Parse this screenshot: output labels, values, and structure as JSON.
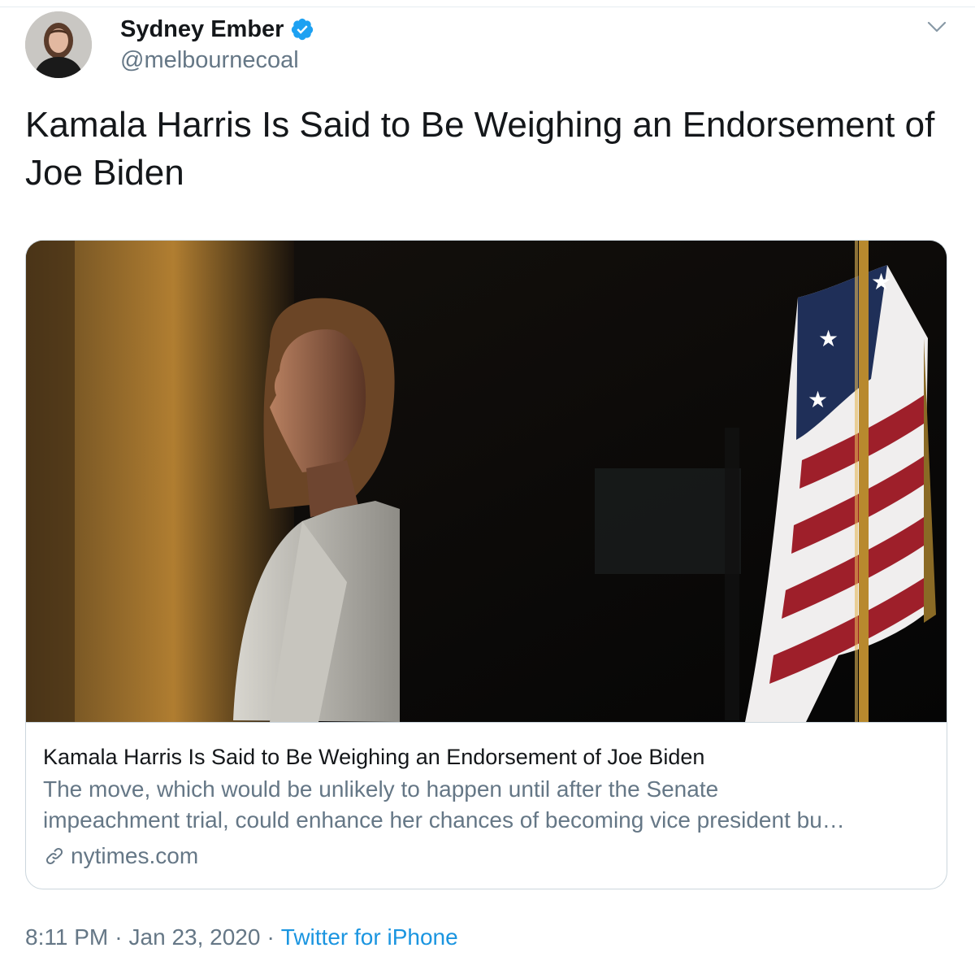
{
  "author": {
    "display_name": "Sydney Ember",
    "handle": "@melbournecoal",
    "verified": true,
    "avatar_icon": "profile-photo"
  },
  "tweet": {
    "text": "Kamala Harris Is Said to Be Weighing an Endorsement of Joe Biden",
    "time": "8:11 PM",
    "date": "Jan 23, 2020",
    "separator": "·",
    "source": "Twitter for iPhone"
  },
  "card": {
    "title": "Kamala Harris Is Said to Be Weighing an Endorsement of Joe Biden",
    "description_line1": "The move, which would be unlikely to happen until after the Senate",
    "description_line2": "impeachment trial, could enhance her chances of becoming vice president bu…",
    "domain": "nytimes.com",
    "image_icon": "photo-kamala-harris-with-flag"
  },
  "colors": {
    "text_primary": "#14171a",
    "text_secondary": "#657786",
    "link_blue": "#1b95e0",
    "verified_blue": "#1da1f2",
    "border": "#ccd6dd"
  }
}
